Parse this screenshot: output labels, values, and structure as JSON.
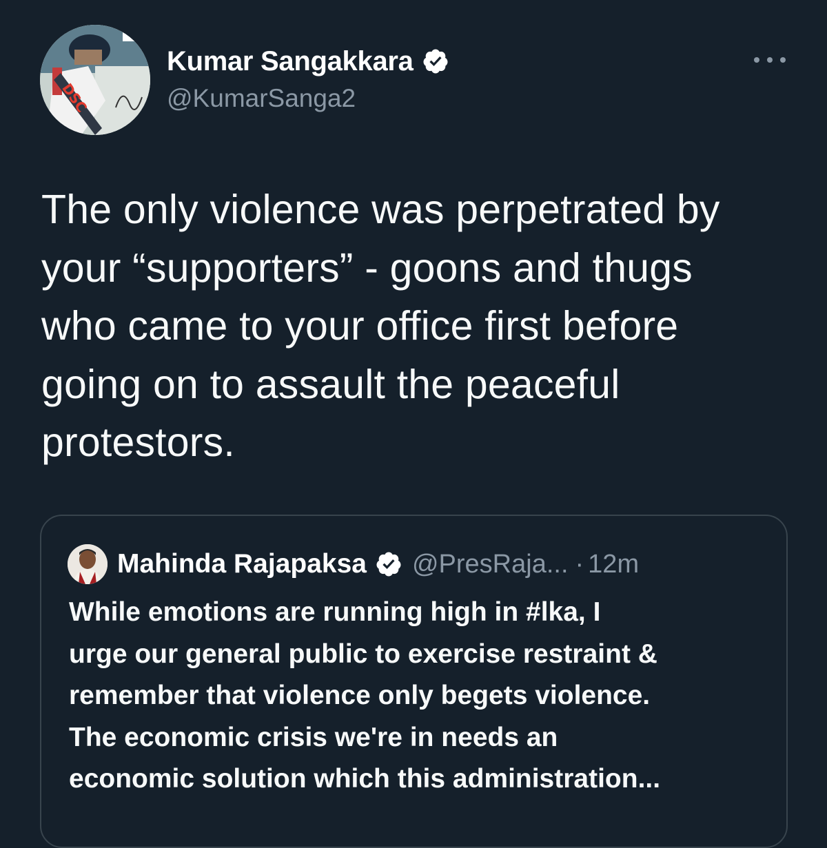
{
  "tweet": {
    "author": {
      "display_name": "Kumar Sangakkara",
      "handle": "@KumarSanga2",
      "verified_icon": "verified-badge-icon"
    },
    "more_icon": "more-horizontal-icon",
    "text": "The only violence was perpetrated by\nyour “supporters” - goons and thugs\nwho came to your office first before\ngoing on to assault the peaceful\nprotestors."
  },
  "quoted_tweet": {
    "author": {
      "display_name": "Mahinda Rajapaksa",
      "handle": "@PresRaja...",
      "verified_icon": "verified-badge-icon"
    },
    "separator": "·",
    "time": "12m",
    "text": "While emotions are running high in #lka, I\nurge our general public to exercise restraint &\nremember that violence only begets violence.\nThe economic crisis we're in needs an\neconomic solution which this administration..."
  },
  "colors": {
    "background": "#15202b",
    "secondary_text": "#8b98a5",
    "border": "#38444d",
    "primary_text": "#f7f9f9"
  }
}
